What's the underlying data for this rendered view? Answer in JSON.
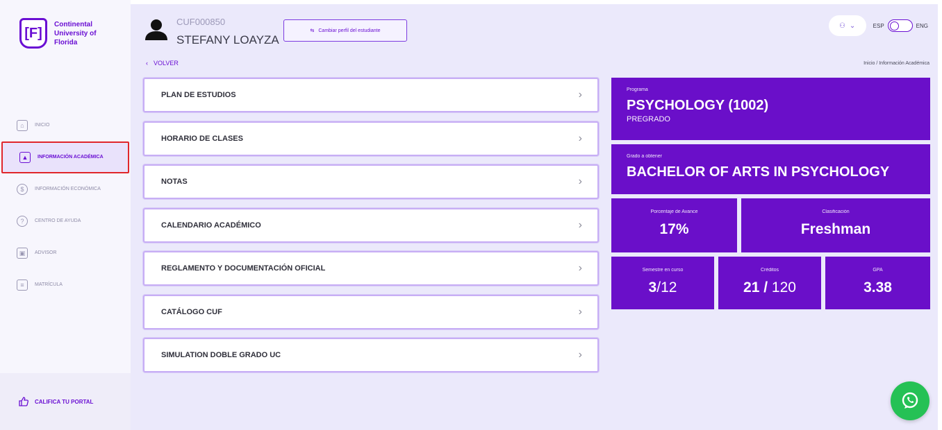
{
  "sidebar": {
    "logo_text": "Continental University of Florida",
    "logo_mark": "[F]",
    "items": [
      {
        "label": "Inicio",
        "icon": "home-icon"
      },
      {
        "label": "Información Académica",
        "icon": "graduation-cap-icon"
      },
      {
        "label": "Información Económica",
        "icon": "dollar-icon"
      },
      {
        "label": "Centro de Ayuda",
        "icon": "help-icon"
      },
      {
        "label": "Advisor",
        "icon": "advisor-icon"
      },
      {
        "label": "Matrícula",
        "icon": "enrollment-icon"
      }
    ],
    "rate_label": "CALIFICA TU PORTAL"
  },
  "header": {
    "student_code": "CUF000850",
    "student_name": "STEFANY LOAYZA",
    "change_profile_label": "Cambiar perfil del estudiante",
    "back_label": "VOLVER",
    "breadcrumb": "Inicio / Información Académica",
    "lang_left": "ESP",
    "lang_right": "ENG"
  },
  "menu": [
    "PLAN DE ESTUDIOS",
    "HORARIO DE CLASES",
    "NOTAS",
    "CALENDARIO ACADÉMICO",
    "REGLAMENTO Y DOCUMENTACIÓN OFICIAL",
    "CATÁLOGO CUF",
    "SIMULATION DOBLE GRADO UC"
  ],
  "cards": {
    "program_label": "Programa",
    "program_value": "PSYCHOLOGY (1002)",
    "program_level": "PREGRADO",
    "degree_label": "Grado a obtener",
    "degree_value": "BACHELOR OF ARTS IN PSYCHOLOGY",
    "progress_label": "Porcentaje de Avance",
    "progress_value": "17%",
    "classification_label": "Clasificación",
    "classification_value": "Freshman",
    "semester_label": "Semestre en curso",
    "semester_current": "3",
    "semester_total": "/12",
    "credits_label": "Créditos",
    "credits_current": "21 /",
    "credits_total": " 120",
    "gpa_label": "GPA",
    "gpa_value": "3.38"
  },
  "colors": {
    "accent": "#6a0fc9",
    "highlight": "#e0262a",
    "whatsapp": "#25c155"
  }
}
